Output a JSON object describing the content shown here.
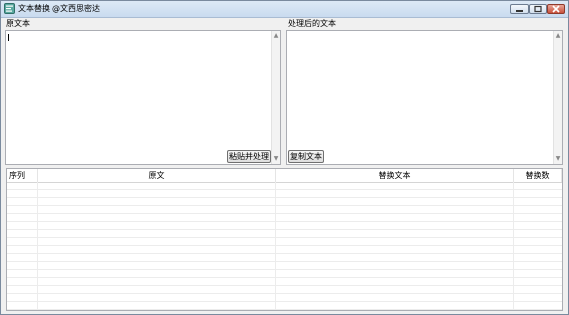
{
  "window": {
    "title": "文本替换",
    "author": "@文西思密达",
    "icon": "app-icon"
  },
  "source_panel": {
    "label": "原文本",
    "value": "",
    "button_label": "粘贴并处理"
  },
  "result_panel": {
    "label": "处理后的文本",
    "value": "",
    "button_label": "复制文本"
  },
  "table": {
    "columns": [
      "序列",
      "原文",
      "替换文本",
      "替换数"
    ],
    "rows": []
  },
  "colors": {
    "titlebar": "#c9dbef",
    "close_button": "#c9513c"
  }
}
